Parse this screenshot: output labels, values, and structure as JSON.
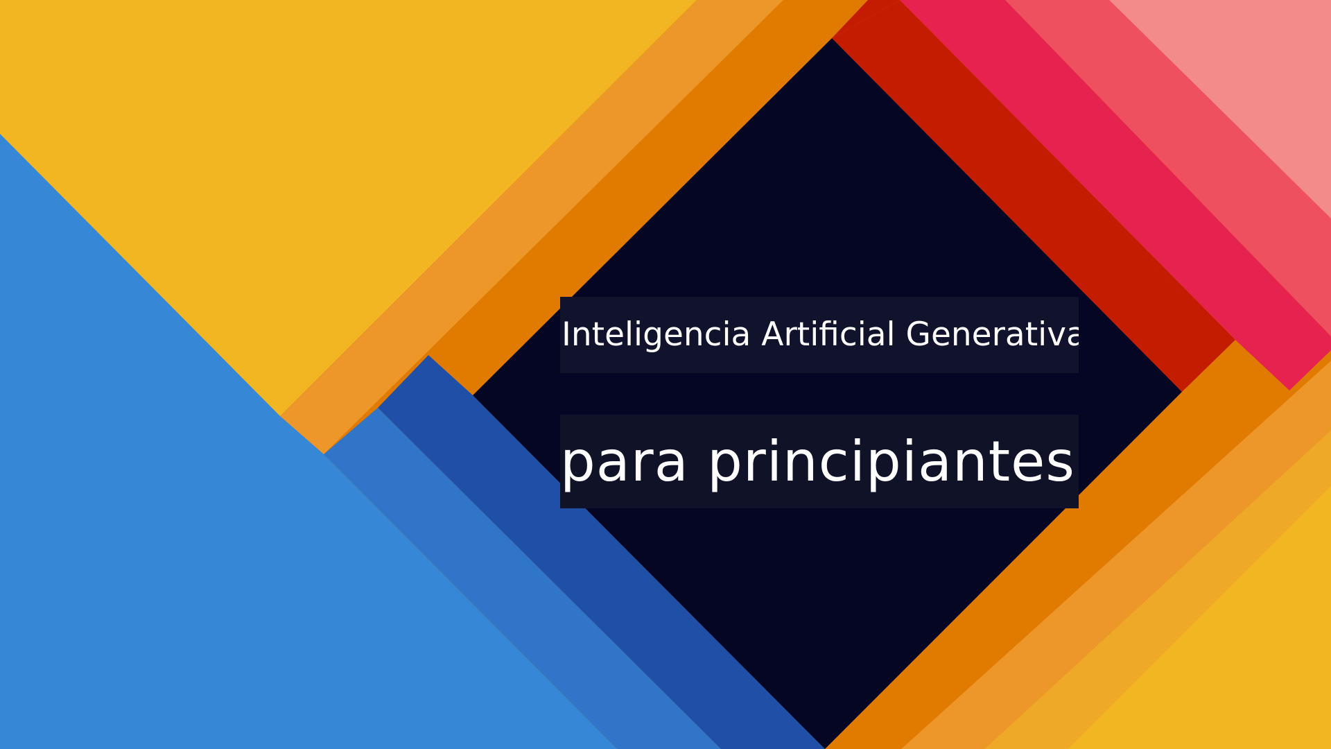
{
  "title": {
    "line1": "Inteligencia Artificial Generativa",
    "line2": "para principiantes"
  },
  "colors": {
    "background_dark": "#050624",
    "yellow": "#f2b623",
    "light_orange": "#ed9629",
    "orange": "#e07b00",
    "red": "#c41c00",
    "magenta_red": "#e6224e",
    "coral": "#ef5060",
    "pink": "#f38b8b",
    "blue": "#3688d6",
    "mid_blue": "#3075c8",
    "dark_blue": "#204fa8",
    "text": "#ffffff",
    "caption_box": "#10132b"
  }
}
